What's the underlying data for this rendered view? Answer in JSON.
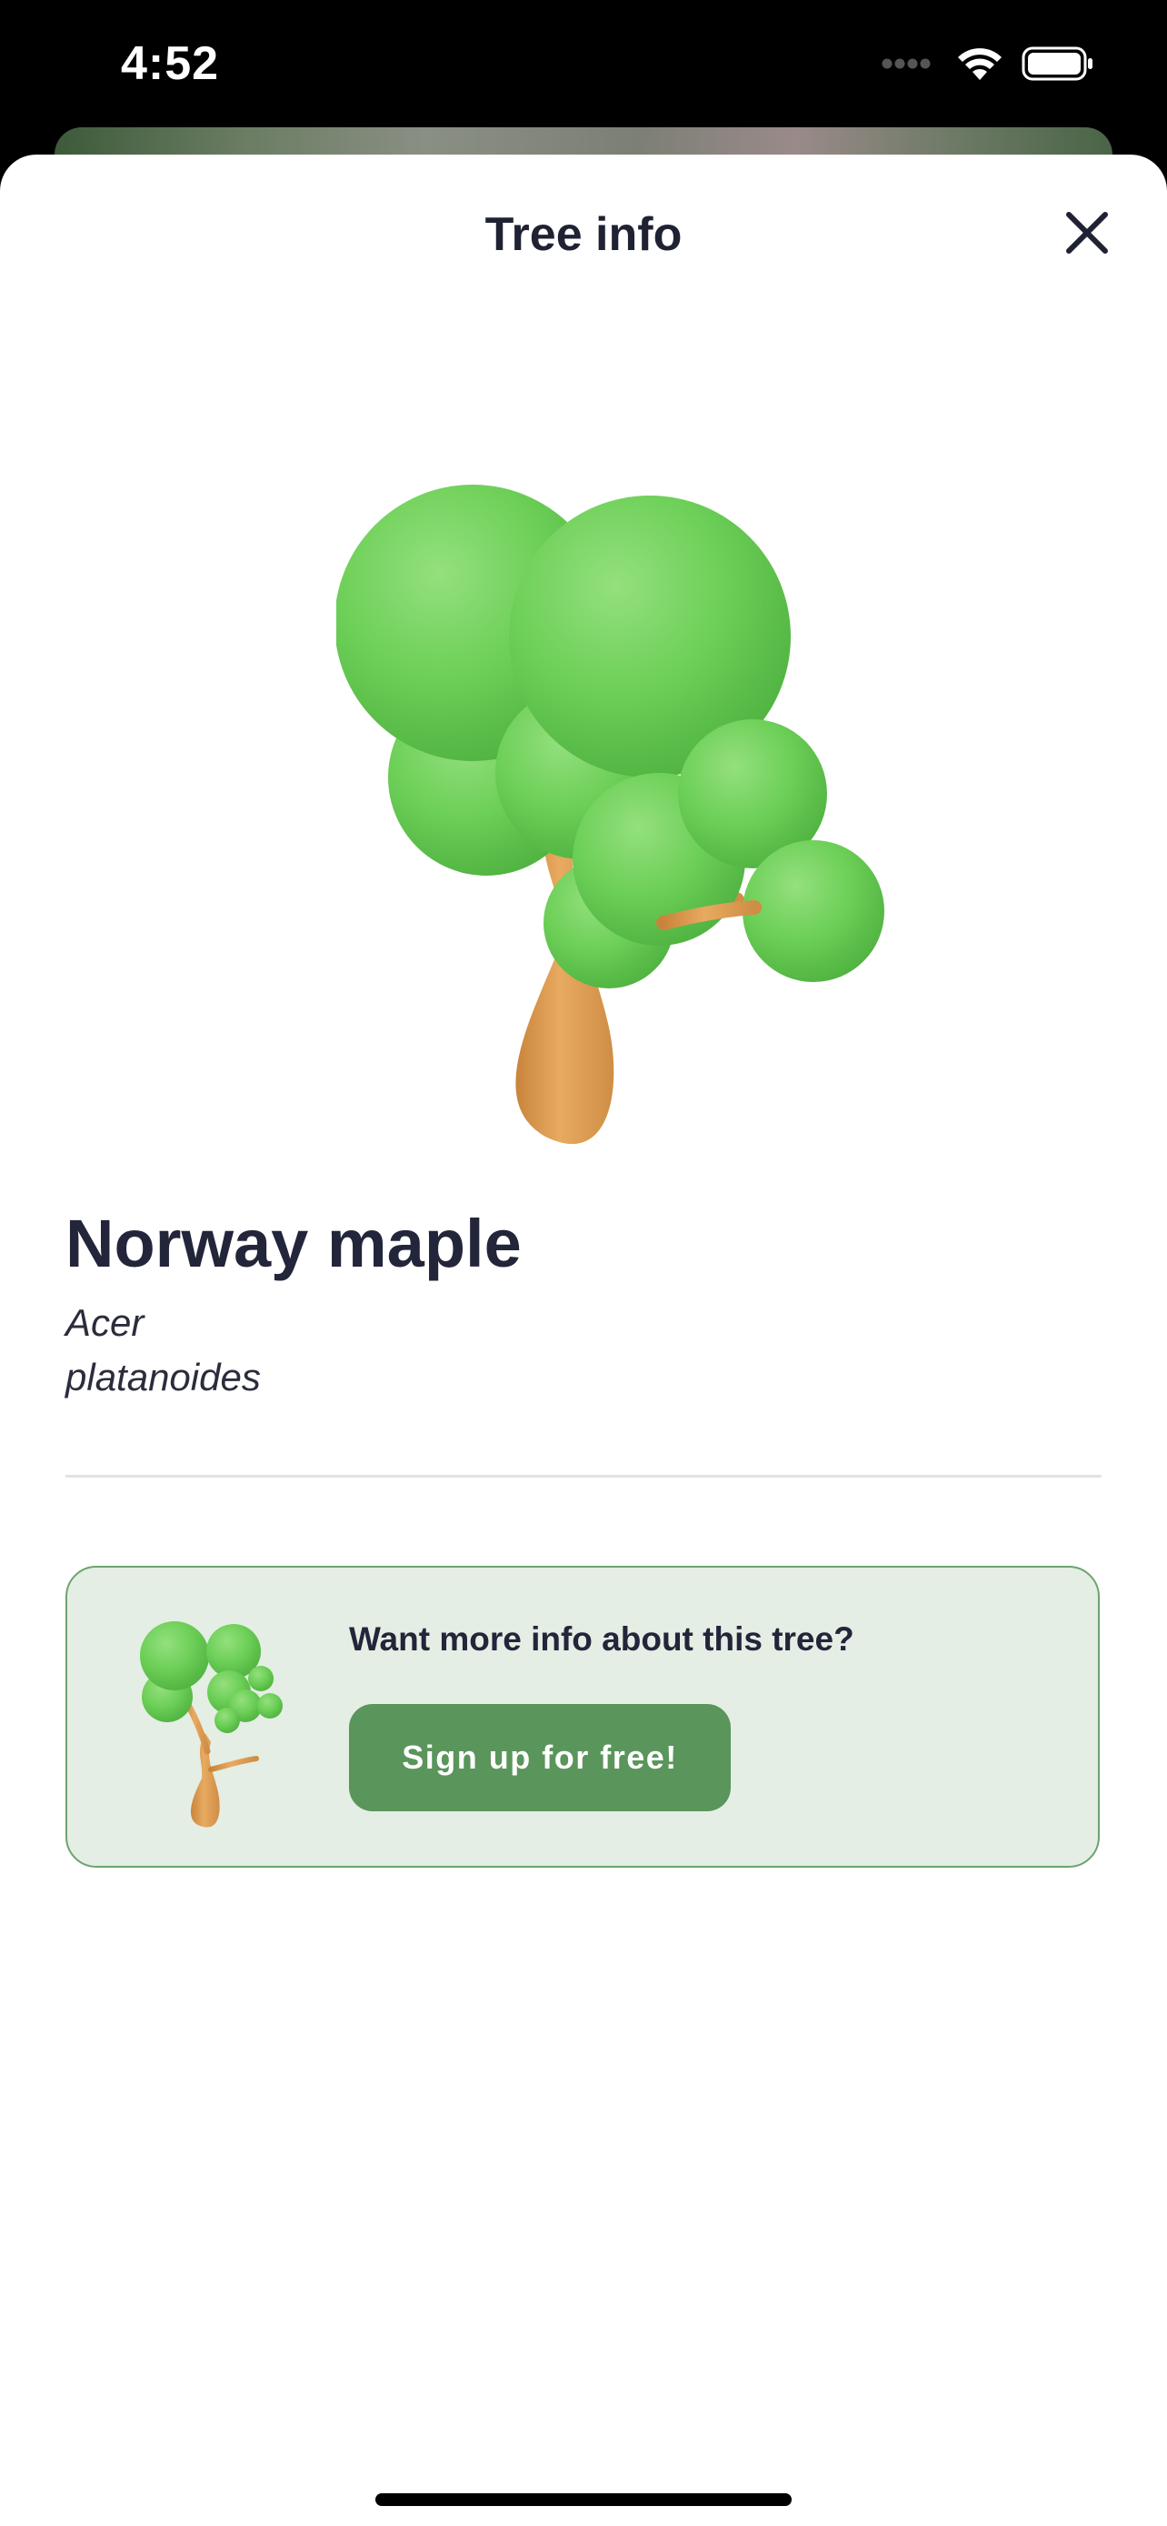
{
  "status_bar": {
    "time": "4:52",
    "icons": [
      "cellular-signal-icon",
      "wifi-icon",
      "battery-icon"
    ]
  },
  "sheet": {
    "title": "Tree info",
    "close_icon": "close-icon"
  },
  "tree": {
    "common_name": "Norway maple",
    "latin_name_lines": [
      "Acer",
      "platanoides"
    ]
  },
  "promo": {
    "question": "Want more info about this tree?",
    "button_label": "Sign up for free!"
  },
  "colors": {
    "text_primary": "#23253a",
    "accent_green": "#5a955b",
    "card_background": "#e4eee4",
    "card_border": "#6ea36e",
    "foliage": "#66cc55",
    "trunk": "#d9994f"
  }
}
